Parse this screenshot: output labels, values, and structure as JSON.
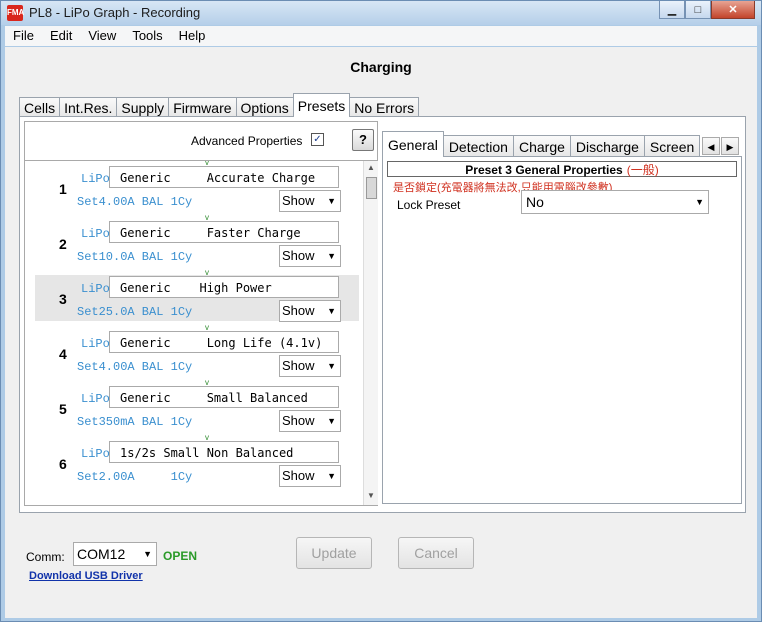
{
  "window": {
    "title": "PL8 - LiPo Graph - Recording",
    "icon_text": "FMA"
  },
  "menu": [
    "File",
    "Edit",
    "View",
    "Tools",
    "Help"
  ],
  "section_title": "Charging",
  "main_tabs": [
    "Cells",
    "Int.Res.",
    "Supply",
    "Firmware",
    "Options",
    "Presets",
    "No Errors"
  ],
  "main_tab_active": "Presets",
  "advanced": {
    "label": "Advanced Properties",
    "checked_glyph": "✓",
    "help": "?"
  },
  "presets": [
    {
      "num": "1",
      "chem": "LiPo",
      "name": "Generic     Accurate Charge",
      "summary": "Set4.00A BAL 1Cy",
      "show": "Show"
    },
    {
      "num": "2",
      "chem": "LiPo",
      "name": "Generic     Faster Charge",
      "summary": "Set10.0A BAL 1Cy",
      "show": "Show"
    },
    {
      "num": "3",
      "chem": "LiPo",
      "name": "Generic    High Power",
      "summary": "Set25.0A BAL 1Cy",
      "show": "Show"
    },
    {
      "num": "4",
      "chem": "LiPo",
      "name": "Generic     Long Life (4.1v)",
      "summary": "Set4.00A BAL 1Cy",
      "show": "Show"
    },
    {
      "num": "5",
      "chem": "LiPo",
      "name": "Generic     Small Balanced",
      "summary": "Set350mA BAL 1Cy",
      "show": "Show"
    },
    {
      "num": "6",
      "chem": "LiPo",
      "name": "1s/2s Small Non Balanced",
      "summary": "Set2.00A     1Cy",
      "show": "Show"
    }
  ],
  "sub_tabs": [
    "General",
    "Detection",
    "Charge",
    "Discharge",
    "Screen"
  ],
  "sub_tab_active": "General",
  "props": {
    "header": "Preset 3  General Properties",
    "header_cn": "(一般)",
    "lock_note": "是否鎖定(充電器將無法改,只能用電腦改參數)",
    "lock_label": "Lock Preset",
    "lock_value": "No"
  },
  "bottom": {
    "comm_label": "Comm:",
    "comm_value": "COM12",
    "comm_status": "OPEN",
    "usb_link": "Download USB Driver",
    "update": "Update",
    "cancel": "Cancel"
  },
  "colors": {
    "accent_blue": "#3a8fcf",
    "status_green": "#2a9a28",
    "note_red": "#d0301f",
    "link_blue": "#1133aa"
  }
}
